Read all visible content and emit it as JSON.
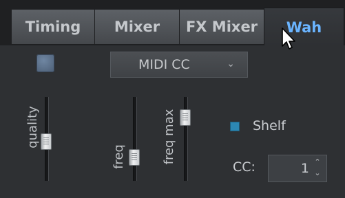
{
  "tabs": [
    {
      "label": "Timing",
      "active": false
    },
    {
      "label": "Mixer",
      "active": false
    },
    {
      "label": "FX Mixer",
      "active": false
    },
    {
      "label": "Wah",
      "active": true
    }
  ],
  "dropdown": {
    "value": "MIDI CC",
    "chevron": "⌄"
  },
  "sliders": {
    "quality": {
      "label": "quality"
    },
    "freq": {
      "label": "freq"
    },
    "freq_max": {
      "label": "freq max"
    }
  },
  "shelf": {
    "label": "Shelf",
    "checked": true
  },
  "cc": {
    "label": "CC:",
    "value": "1",
    "up": "⌃",
    "down": "⌄"
  },
  "colors": {
    "accent": "#6ab4ff",
    "checkbox": "#2c87b3",
    "led": "#5f7590"
  }
}
